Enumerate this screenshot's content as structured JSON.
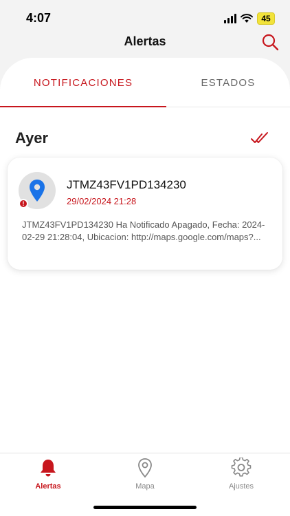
{
  "status_bar": {
    "time": "4:07",
    "battery": "45"
  },
  "header": {
    "title": "Alertas",
    "search_icon": "search-icon"
  },
  "tabs": [
    {
      "label": "NOTIFICACIONES",
      "active": true
    },
    {
      "label": "ESTADOS",
      "active": false
    }
  ],
  "section": {
    "title": "Ayer",
    "mark_read_icon": "double-check-icon"
  },
  "notifications": [
    {
      "title": "JTMZ43FV1PD134230",
      "date": "29/02/2024 21:28",
      "body": "JTMZ43FV1PD134230 Ha Notificado Apagado, Fecha: 2024-02-29 21:28:04, Ubicacion: http://maps.google.com/maps?...",
      "icon": "location-pin-icon",
      "badge": "!"
    }
  ],
  "tabbar": [
    {
      "label": "Alertas",
      "icon": "bell-icon",
      "active": true
    },
    {
      "label": "Mapa",
      "icon": "map-pin-icon",
      "active": false
    },
    {
      "label": "Ajustes",
      "icon": "gear-icon",
      "active": false
    }
  ],
  "colors": {
    "accent": "#c7161d",
    "pin": "#1a73e8",
    "battery": "#f2e33a"
  }
}
